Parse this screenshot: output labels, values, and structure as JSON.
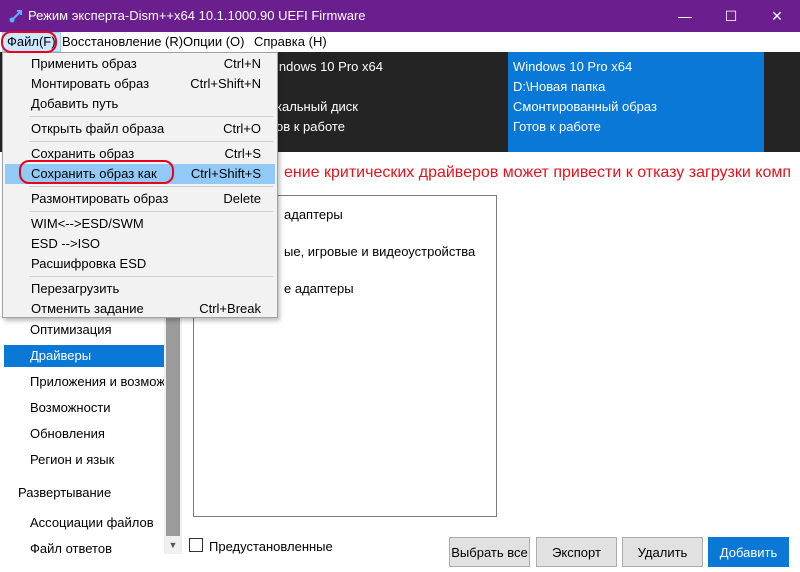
{
  "titlebar": {
    "title": "Режим эксперта-Dism++x64 10.1.1000.90 UEFI Firmware",
    "minimize": "—",
    "maximize": "☐",
    "close": "✕"
  },
  "menubar": {
    "file": "Файл(F)",
    "restore": "Восстановление (R)",
    "options": "Опции (O)",
    "help": "Справка (H)"
  },
  "panel_left": {
    "line1": "indows 10 Pro x64",
    "line2": "кальный диск",
    "line3": "ов к работе"
  },
  "panel_right": {
    "line1": "Windows 10 Pro x64",
    "line2": "D:\\Новая папка",
    "line3": "Смонтированный образ",
    "line4": "Готов к работе"
  },
  "sidebar": {
    "items": [
      "Оптимизация",
      "Драйверы",
      "Приложения и возможности",
      "Возможности",
      "Обновления",
      "Регион и язык"
    ],
    "group_deploy": "Развертывание",
    "deploy_items": [
      "Ассоциации файлов",
      "Файл ответов"
    ],
    "selected_index": 1
  },
  "main": {
    "warning": "ение критических драйверов может привести к отказу загрузки комп",
    "drivers": [
      "адаптеры",
      "ые, игровые и видеоустройства",
      "е адаптеры"
    ],
    "preinstalled_label": "Предустановленные",
    "buttons": {
      "select_all": "Выбрать все",
      "export": "Экспорт",
      "delete": "Удалить",
      "add": "Добавить"
    }
  },
  "file_menu": {
    "items": [
      {
        "label": "Применить образ",
        "shortcut": "Ctrl+N"
      },
      {
        "label": "Монтировать образ",
        "shortcut": "Ctrl+Shift+N"
      },
      {
        "label": "Добавить путь",
        "shortcut": ""
      },
      {
        "label": "Открыть файл образа",
        "shortcut": "Ctrl+O"
      },
      {
        "label": "Сохранить образ",
        "shortcut": "Ctrl+S"
      },
      {
        "label": "Сохранить образ как",
        "shortcut": "Ctrl+Shift+S"
      },
      {
        "label": "Размонтировать образ",
        "shortcut": "Delete"
      },
      {
        "label": "WIM<-->ESD/SWM",
        "shortcut": ""
      },
      {
        "label": "ESD -->ISO",
        "shortcut": ""
      },
      {
        "label": "Расшифровка ESD",
        "shortcut": ""
      },
      {
        "label": "Перезагрузить",
        "shortcut": ""
      },
      {
        "label": "Отменить задание",
        "shortcut": "Ctrl+Break"
      }
    ],
    "highlighted_index": 5
  },
  "colors": {
    "titlebar": "#6b1f8f",
    "accent": "#0a78d7",
    "warning": "#e8121c",
    "highlight_oval": "#e8001c"
  }
}
